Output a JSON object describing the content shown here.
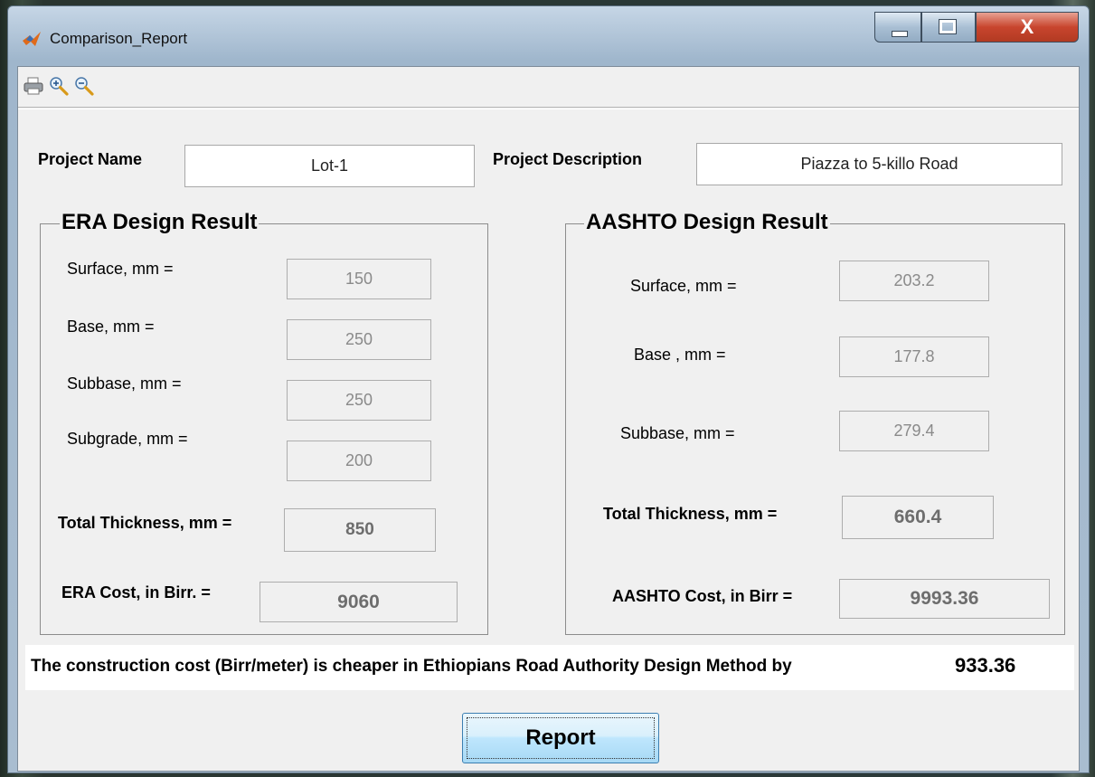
{
  "window": {
    "title": "Comparison_Report",
    "close_glyph": "X"
  },
  "toolbar": {
    "icons": [
      "print-icon",
      "zoom-in-icon",
      "zoom-out-icon"
    ]
  },
  "project": {
    "name_label": "Project Name",
    "name_value": "Lot-1",
    "desc_label": "Project Description",
    "desc_value": "Piazza to 5-killo  Road"
  },
  "era": {
    "title": "ERA Design Result",
    "surface_label": "Surface, mm =",
    "surface_value": "150",
    "base_label": "Base, mm =",
    "base_value": "250",
    "subbase_label": "Subbase, mm =",
    "subbase_value": "250",
    "subgrade_label": "Subgrade, mm =",
    "subgrade_value": "200",
    "total_label": "Total Thickness, mm =",
    "total_value": "850",
    "cost_label": "ERA Cost, in Birr. =",
    "cost_value": "9060"
  },
  "aashto": {
    "title": "AASHTO Design Result",
    "surface_label": "Surface, mm =",
    "surface_value": "203.2",
    "base_label": "Base , mm  =",
    "base_value": "177.8",
    "subbase_label": "Subbase, mm =",
    "subbase_value": "279.4",
    "total_label": "Total Thickness, mm =",
    "total_value": "660.4",
    "cost_label": "AASHTO Cost, in Birr =",
    "cost_value": "9993.36"
  },
  "result": {
    "text": "The construction cost (Birr/meter) is cheaper in Ethiopians Road Authority Design Method by",
    "value": "933.36"
  },
  "buttons": {
    "report": "Report"
  },
  "colors": {
    "close_red": "#c8452e",
    "button_blue": "#bee6fd"
  }
}
